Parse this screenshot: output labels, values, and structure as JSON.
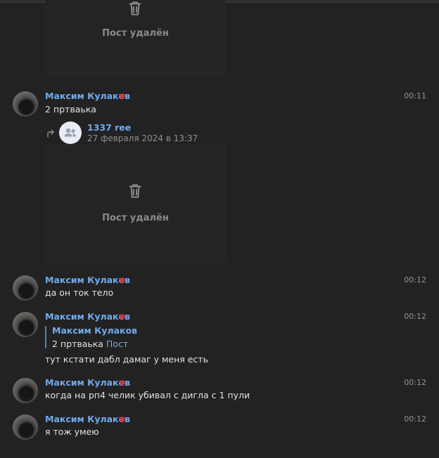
{
  "deleted_post_text": "Пост удалён",
  "messages": [
    {
      "author": "Максим Кулаков",
      "time": "00:11",
      "text": "2 пртваька",
      "forward": {
        "group_name": "1337 ree",
        "date": "27 февраля 2024 в 13:37",
        "deleted_text": "Пост удалён"
      }
    },
    {
      "author": "Максим Кулаков",
      "time": "00:12",
      "text": "да он ток тело"
    },
    {
      "author": "Максим Кулаков",
      "time": "00:12",
      "reply": {
        "author": "Максим Кулаков",
        "text": "2 пртваька",
        "attachment": "Пост"
      },
      "text": "тут кстати дабл дамаг у меня есть"
    },
    {
      "author": "Максим Кулаков",
      "time": "00:12",
      "text": "когда на рп4 челик убивал с дигла с 1 пули"
    },
    {
      "author": "Максим Кулаков",
      "time": "00:12",
      "text": "я тож умею"
    }
  ],
  "colors": {
    "background": "#222222",
    "link": "#71aaeb",
    "text": "#e1e3e6",
    "muted": "#939393"
  },
  "icons": {
    "trash": "trash-icon",
    "forward": "forward-icon",
    "group": "group-icon",
    "status": "status-emoji-icon"
  }
}
